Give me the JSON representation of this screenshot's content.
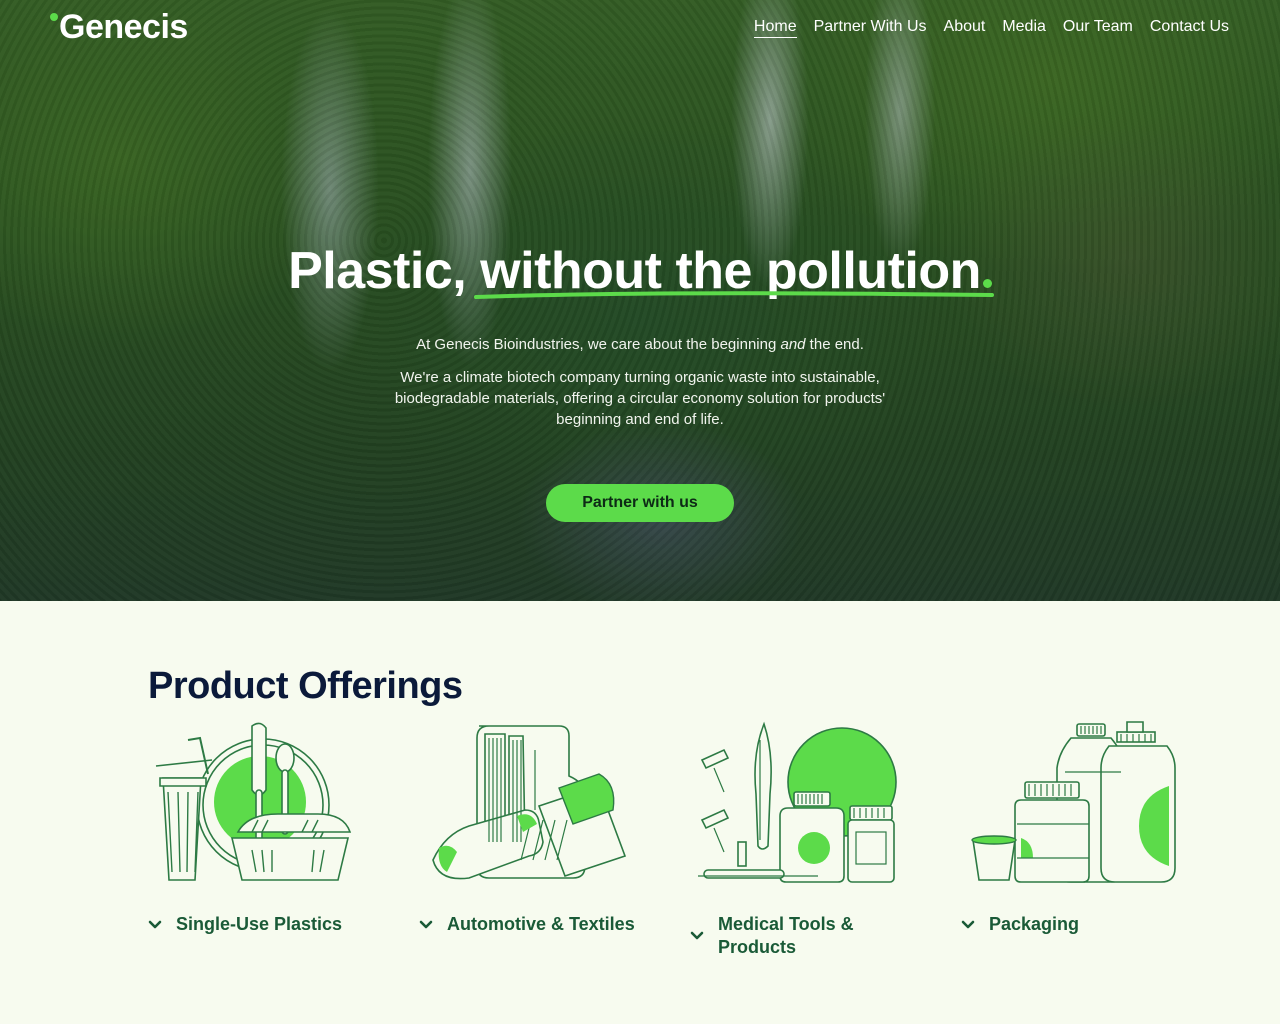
{
  "header": {
    "logo": "Genecis",
    "nav": [
      "Home",
      "Partner With Us",
      "About",
      "Media",
      "Our Team",
      "Contact Us"
    ]
  },
  "hero": {
    "headline_start": "Plastic, ",
    "headline_highlight": "without the pollution",
    "intro_before": "At Genecis Bioindustries, we care about the beginning ",
    "intro_emphasis": "and",
    "intro_after": " the end.",
    "body": "We're a climate biotech company turning organic waste into sustainable, biodegradable materials, offering a circular economy solution for products' beginning and end of life.",
    "cta": "Partner with us"
  },
  "products": {
    "title": "Product Offerings",
    "items": [
      {
        "label": "Single-Use Plastics"
      },
      {
        "label": "Automotive & Textiles"
      },
      {
        "label": "Medical Tools & Products"
      },
      {
        "label": "Packaging"
      }
    ]
  },
  "colors": {
    "accent": "#5cdb4a",
    "label_green": "#1a5a37",
    "heading_navy": "#0b1a3a",
    "section_bg": "#f7fbef"
  }
}
